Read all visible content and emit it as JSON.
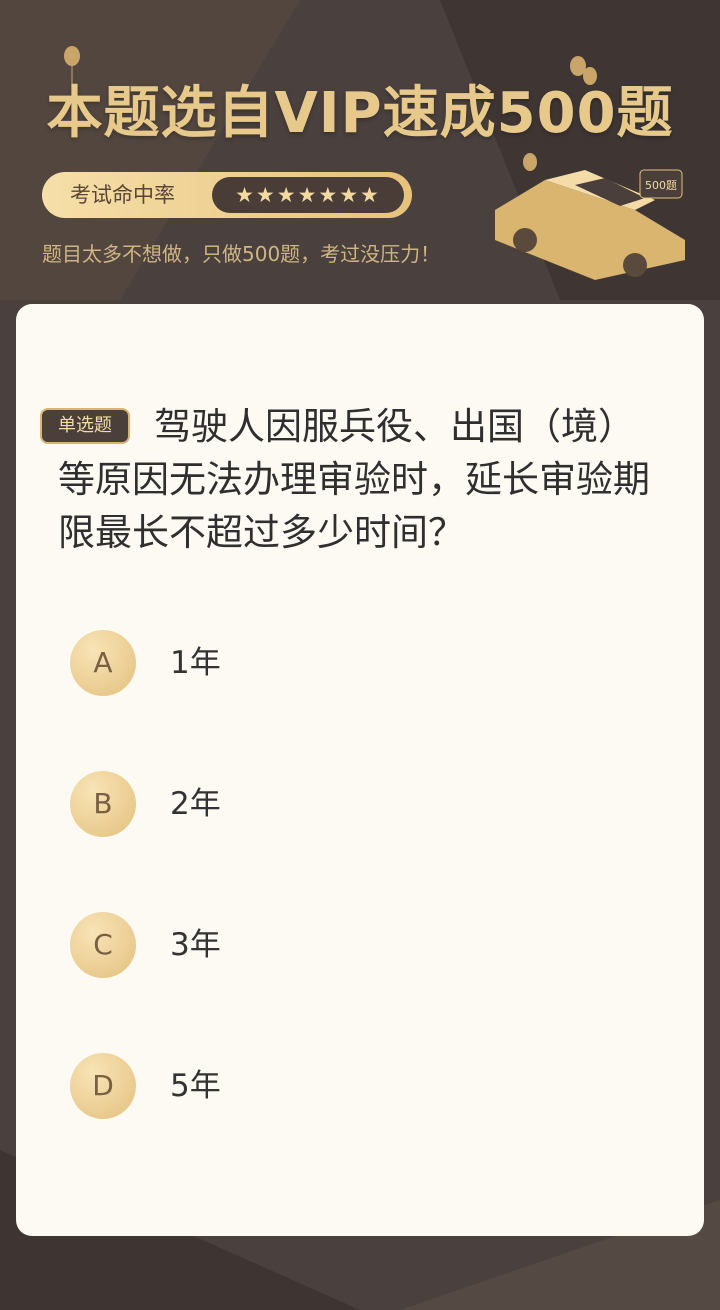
{
  "banner": {
    "title": "本题选自VIP速成500题",
    "rate_label": "考试命中率",
    "stars": "★★★★★★★",
    "tagline": "题目太多不想做，只做500题，考过没压力！",
    "car_badge": "500题"
  },
  "question": {
    "type_label": "单选题",
    "text": "驾驶人因服兵役、出国（境）等原因无法办理审验时，延长审验期限最长不超过多少时间？"
  },
  "options": [
    {
      "letter": "A",
      "text": "1年"
    },
    {
      "letter": "B",
      "text": "2年"
    },
    {
      "letter": "C",
      "text": "3年"
    },
    {
      "letter": "D",
      "text": "5年"
    }
  ],
  "colors": {
    "background": "#4a403d",
    "gold": "#e8c98c",
    "card": "#fdfaf3"
  }
}
